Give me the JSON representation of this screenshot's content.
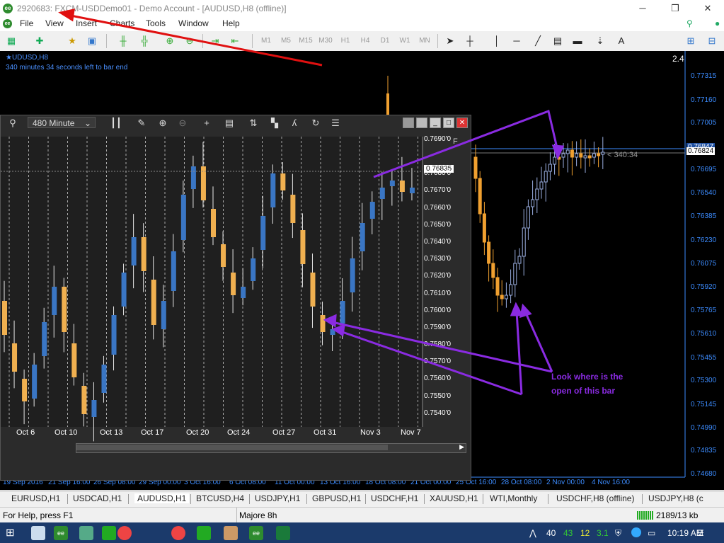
{
  "window": {
    "title": "2920683: FXCM-USDDemo01 - Demo Account - [AUDUSD,H8 (offline)]",
    "controls": [
      "─",
      "❐",
      "✕"
    ]
  },
  "menu": [
    "File",
    "View",
    "Insert",
    "Charts",
    "Tools",
    "Window",
    "Help"
  ],
  "timeframes": [
    "M1",
    "M5",
    "M15",
    "M30",
    "H1",
    "H4",
    "D1",
    "W1",
    "MN"
  ],
  "main_chart": {
    "symbol_label": "★UDUSD,H8",
    "bar_end_text": "340 minutes 34 seconds left to bar end",
    "top_right_value": "2.4",
    "price_labels": [
      "0.77315",
      "0.77160",
      "0.77005",
      "0.76847",
      "0.76824",
      "0.76695",
      "0.76540",
      "0.76385",
      "0.76230",
      "0.76075",
      "0.75920",
      "0.75765",
      "0.75610",
      "0.75455",
      "0.75300",
      "0.75145",
      "0.74990",
      "0.74835",
      "0.74680"
    ],
    "countdown": "< 340:34",
    "time_labels": [
      "19 Sep 2016",
      "21 Sep 16:00",
      "26 Sep 08:00",
      "29 Sep 00:00",
      "3 Oct 16:00",
      "6 Oct 08:00",
      "11 Oct 00:00",
      "13 Oct 16:00",
      "18 Oct 08:00",
      "21 Oct 00:00",
      "25 Oct 16:00",
      "28 Oct 08:00",
      "2 Nov 00:00",
      "4 Nov 16:00"
    ]
  },
  "sub_chart": {
    "timeframe": "480 Minute",
    "current_price": "0.76835",
    "price_labels": [
      "0.7690'0",
      "0.7680'0",
      "0.7670'0",
      "0.7660'0",
      "0.7650'0",
      "0.7640'0",
      "0.7630'0",
      "0.7620'0",
      "0.7610'0",
      "0.7600'0",
      "0.7590'0",
      "0.7580'0",
      "0.7570'0",
      "0.7560'0",
      "0.7550'0",
      "0.7540'0"
    ],
    "date_labels": [
      "Oct 6",
      "Oct 10",
      "Oct 13",
      "Oct 17",
      "Oct 20",
      "Oct 24",
      "Oct 27",
      "Oct 31",
      "Nov 3",
      "Nov 7"
    ],
    "corner_letter": "F"
  },
  "annotation": {
    "line1": "Look where is the",
    "line2": "open of this bar",
    "color": "#8a2be2"
  },
  "tabs": [
    "EURUSD,H1",
    "USDCAD,H1",
    "AUDUSD,H1",
    "BTCUSD,H4",
    "USDJPY,H1",
    "GBPUSD,H1",
    "USDCHF,H1",
    "XAUUSD,H1",
    "WTI,Monthly",
    "USDCHF,H8 (offline)",
    "USDJPY,H8 (c"
  ],
  "status": {
    "help": "For Help, press F1",
    "profile": "Majore 8h",
    "traffic": "2189/13 kb"
  },
  "taskbar": {
    "tray_numbers": [
      "40",
      "43",
      "12",
      "3.1"
    ],
    "clock": "10:19 AM",
    "up_arrow": "⋀"
  },
  "colors": {
    "bull": "#3a76c4",
    "bear": "#f0a030",
    "main_bg": "#000000",
    "sub_bg": "#2b2b2b",
    "axis_text": "#3c8cff"
  }
}
